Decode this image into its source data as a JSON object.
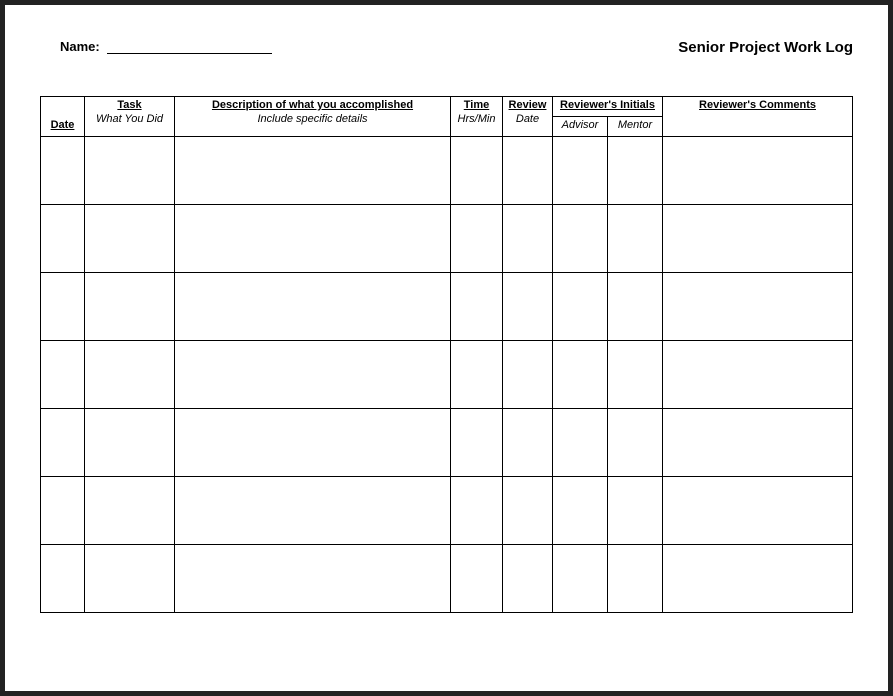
{
  "header": {
    "name_label": "Name:",
    "title": "Senior Project Work Log"
  },
  "columns": {
    "date": {
      "main": "Date"
    },
    "task": {
      "main": "Task",
      "sub": "What You Did"
    },
    "description": {
      "main": "Description of what you accomplished",
      "sub": "Include specific details"
    },
    "time": {
      "main": "Time",
      "sub": "Hrs/Min"
    },
    "review": {
      "main": "Review",
      "sub": "Date"
    },
    "reviewer_initials": {
      "main": "Reviewer's Initials",
      "sub_advisor": "Advisor",
      "sub_mentor": "Mentor"
    },
    "comments": {
      "main": "Reviewer's Comments"
    }
  },
  "row_count": 7
}
